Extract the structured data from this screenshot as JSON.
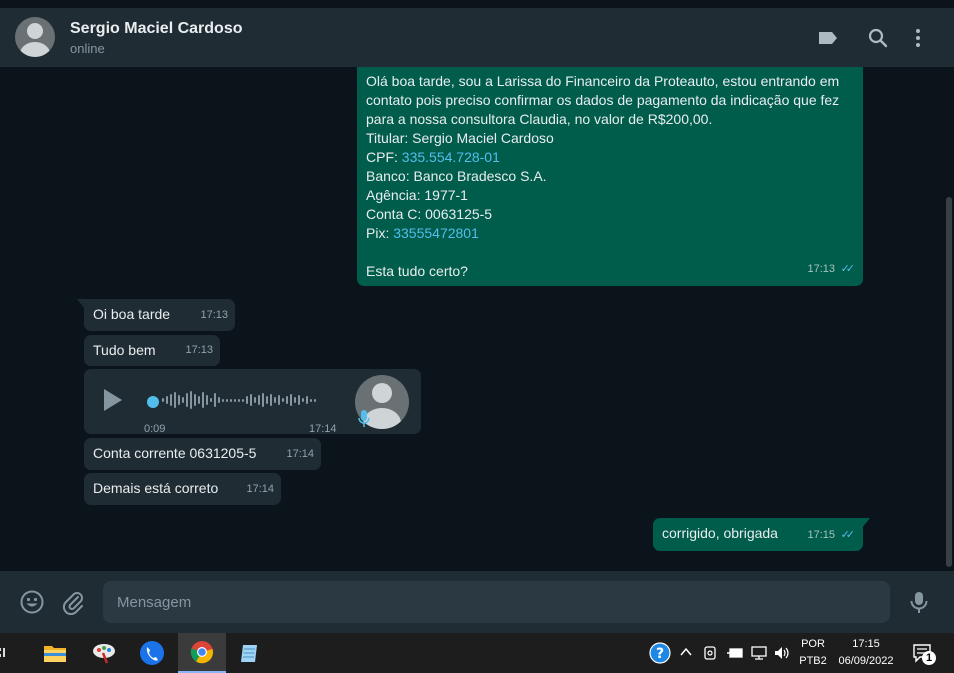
{
  "header": {
    "contact_name": "Sergio Maciel Cardoso",
    "status": "online",
    "icons": [
      "label-icon",
      "search-icon",
      "menu-icon"
    ]
  },
  "messages": {
    "m1": {
      "direction": "out",
      "lines": [
        "Olá boa tarde, sou a Larissa do Financeiro da Proteauto, estou entrando em",
        "contato pois preciso confirmar os dados de pagamento da indicação que fez",
        "para a nossa consultora Claudia, no valor de R$200,00.",
        "Titular: Sergio Maciel Cardoso"
      ],
      "cpf_label": "CPF: ",
      "cpf_value": "335.554.728-01",
      "bank": "Banco: Banco Bradesco S.A.",
      "agency": "Agência: 1977-1",
      "account": "Conta C: 0063125-5",
      "pix_label": "Pix: ",
      "pix_value": "33555472801",
      "closing": "Esta tudo certo?",
      "time": "17:13"
    },
    "m2": {
      "direction": "in",
      "text": "Oi boa tarde",
      "time": "17:13"
    },
    "m3": {
      "direction": "in",
      "text": "Tudo bem",
      "time": "17:13"
    },
    "m4": {
      "direction": "in",
      "type": "voice",
      "duration": "0:09",
      "time": "17:14"
    },
    "m5": {
      "direction": "in",
      "text": "Conta corrente 0631205-5",
      "time": "17:14"
    },
    "m6": {
      "direction": "in",
      "text": "Demais está correto",
      "time": "17:14"
    },
    "m7": {
      "direction": "out",
      "text": "corrigido, obrigada",
      "time": "17:15"
    }
  },
  "composer": {
    "placeholder": "Mensagem",
    "icons": [
      "emoji-icon",
      "attach-icon",
      "microphone-icon"
    ]
  },
  "taskbar": {
    "apps": [
      "task-view-icon",
      "file-explorer-icon",
      "paint-icon",
      "phone-app-icon",
      "chrome-icon",
      "notepad-icon"
    ],
    "language": "POR",
    "layout": "PTB2",
    "clock_time": "17:15",
    "clock_date": "06/09/2022",
    "notification_count": "1"
  },
  "colors": {
    "outgoing_bubble": "#005c4b",
    "incoming_bubble": "#202c33",
    "link": "#53bdeb",
    "header": "#202c33"
  }
}
